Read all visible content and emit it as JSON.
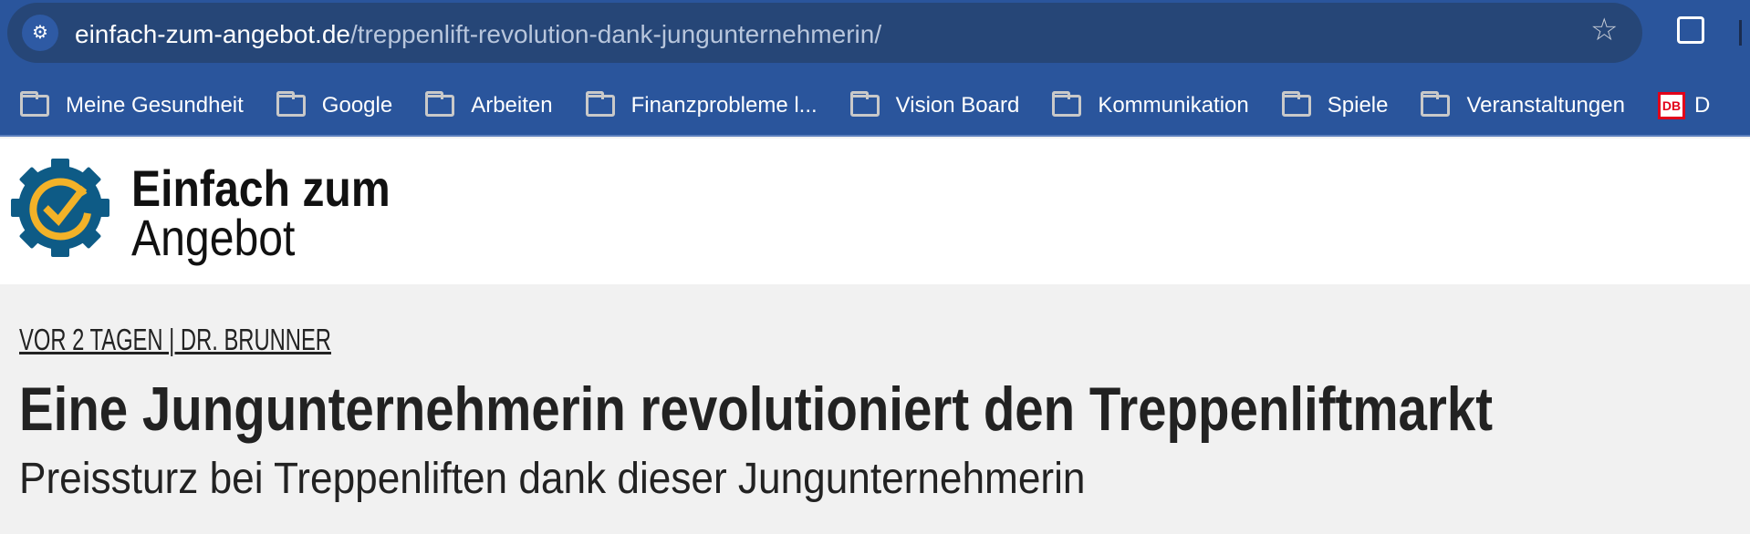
{
  "browser": {
    "url_domain": "einfach-zum-angebot.de",
    "url_path": "/treppenlift-revolution-dank-jungunternehmerin/",
    "bookmarks": [
      {
        "label": "Meine Gesundheit"
      },
      {
        "label": "Google"
      },
      {
        "label": "Arbeiten"
      },
      {
        "label": "Finanzprobleme l..."
      },
      {
        "label": "Vision Board"
      },
      {
        "label": "Kommunikation"
      },
      {
        "label": "Spiele"
      },
      {
        "label": "Veranstaltungen"
      },
      {
        "label": "D",
        "icon": "DB"
      }
    ]
  },
  "site": {
    "logo_line1": "Einfach zum",
    "logo_line2": "Angebot",
    "logo_colors": {
      "gear": "#0e5b86",
      "check": "#f3b228"
    }
  },
  "article": {
    "byline": "VOR 2 TAGEN | DR. BRUNNER",
    "title": "Eine Jungunternehmerin revolutioniert den Treppenliftmarkt",
    "subtitle": "Preissturz bei Treppenliften dank dieser Jungunternehmerin"
  }
}
